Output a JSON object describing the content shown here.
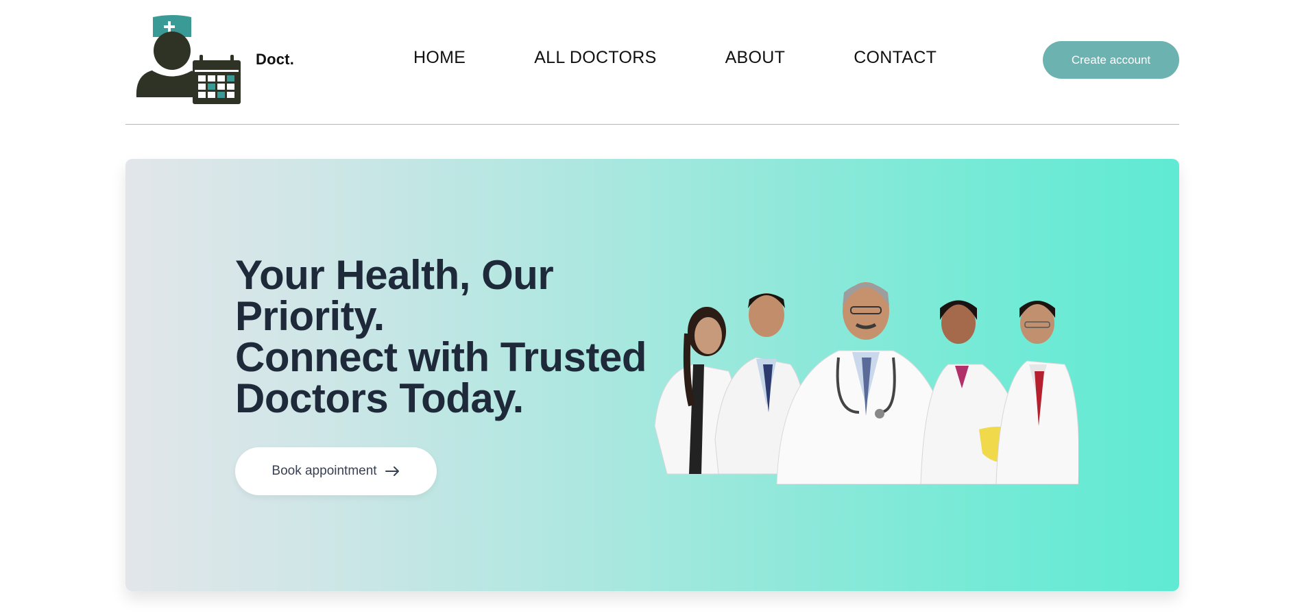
{
  "header": {
    "brand": "Doct.",
    "nav": [
      {
        "label": "HOME"
      },
      {
        "label": "ALL DOCTORS"
      },
      {
        "label": "ABOUT"
      },
      {
        "label": "CONTACT"
      }
    ],
    "create_account_label": "Create account"
  },
  "hero": {
    "title_line1": "Your Health, Our",
    "title_line2": "Priority.",
    "title_line3": "Connect with Trusted",
    "title_line4": "Doctors Today.",
    "book_label": "Book appointment",
    "book_icon": "arrow-right-icon",
    "image_icon": "doctors-group-image"
  },
  "colors": {
    "accent": "#6cb2b1",
    "logo_teal": "#3a9a96",
    "logo_dark": "#2f3326",
    "hero_start": "#e2e6ea",
    "hero_end": "#5fead3",
    "title": "#1e2a3a"
  }
}
